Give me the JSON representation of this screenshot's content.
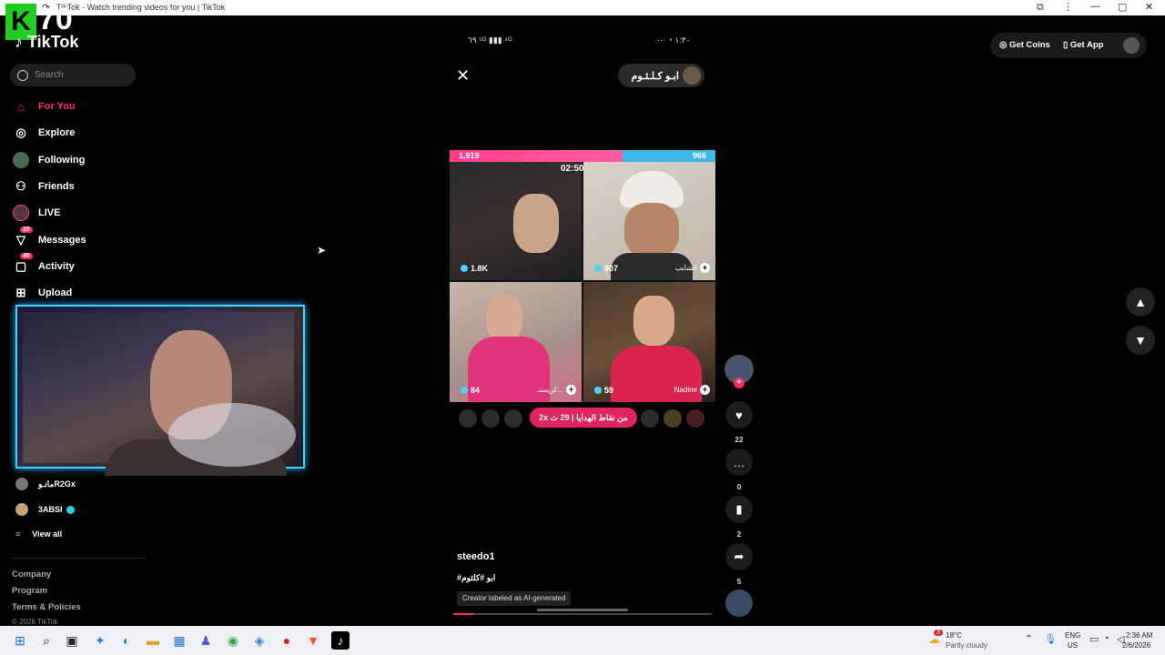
{
  "browser": {
    "tab_title": "TikTok - Watch trending videos for you | TikTok",
    "minimize": "—",
    "maximize": "▢",
    "close": "✕"
  },
  "overlay": {
    "badge_letter": "K",
    "badge_number": "70"
  },
  "sidebar": {
    "logo": "TikTok",
    "search_placeholder": "Search",
    "nav": [
      {
        "label": "For You",
        "icon": "home-icon",
        "active": true
      },
      {
        "label": "Explore",
        "icon": "compass-icon"
      },
      {
        "label": "Following",
        "icon": "following-avatar-icon"
      },
      {
        "label": "Friends",
        "icon": "friends-icon"
      },
      {
        "label": "LIVE",
        "icon": "live-icon"
      },
      {
        "label": "Messages",
        "icon": "messages-icon",
        "badge": "25"
      },
      {
        "label": "Activity",
        "icon": "activity-icon",
        "badge": "40"
      },
      {
        "label": "Upload",
        "icon": "upload-icon"
      }
    ],
    "following_accounts": [
      {
        "name": "مانـوR2Gx"
      },
      {
        "name": "3ABSI"
      }
    ],
    "view_all": "View all",
    "footer": [
      "Company",
      "Program",
      "Terms & Policies"
    ],
    "copyright": "© 2026 TikTok"
  },
  "video": {
    "status_left": "٦٩ ⁵ᴳ ▮▮▮ ⁴ᴳ",
    "status_right": "··· ◔ ١:٣٠",
    "host_name": "ابـو كـلـثـوم",
    "battle_left": "1,919",
    "battle_right": "966",
    "timer": "02:50",
    "tiles": [
      {
        "count": "1.8K",
        "name": ""
      },
      {
        "count": "907",
        "name": "الشايب"
      },
      {
        "count": "84",
        "name": "كريستـ..."
      },
      {
        "count": "59",
        "name": "Nadine"
      }
    ],
    "gift_pill": "2x من نقاط الهدايا | 29 ث"
  },
  "actions": [
    {
      "icon": "heart-icon",
      "count": "22"
    },
    {
      "icon": "comment-icon",
      "count": "0"
    },
    {
      "icon": "bookmark-icon",
      "count": "2"
    },
    {
      "icon": "share-icon",
      "count": "5"
    }
  ],
  "caption": {
    "username": "steedo1",
    "tags": "#ابو #كلثوم",
    "ai_label": "Creator labeled as AI-generated",
    "progress": 0.08
  },
  "header": {
    "get_coins": "Get Coins",
    "get_app": "Get App"
  },
  "taskbar": {
    "weather_temp": "18°C",
    "weather_desc": "Partly cloudy",
    "weather_badge": "3",
    "lang": "ENG",
    "region": "US",
    "time": "2:36 AM",
    "date": "2/6/2026"
  }
}
